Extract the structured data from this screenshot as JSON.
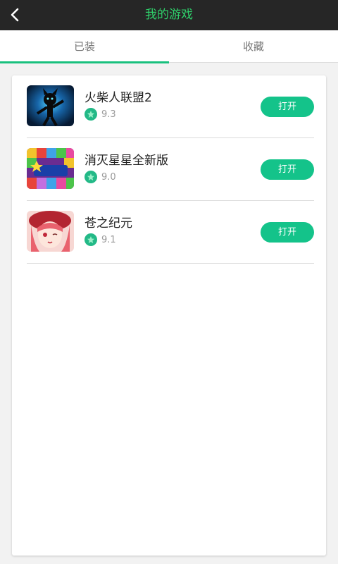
{
  "header": {
    "title": "我的游戏",
    "back_icon": "chevron-left-icon"
  },
  "tabs": [
    {
      "label": "已装",
      "active": true
    },
    {
      "label": "收藏",
      "active": false
    }
  ],
  "games": [
    {
      "name": "火柴人联盟2",
      "rating": "9.3",
      "action": "打开",
      "icon": "stickman-league-game-icon"
    },
    {
      "name": "消灭星星全新版",
      "rating": "9.0",
      "action": "打开",
      "icon": "popstar-game-icon"
    },
    {
      "name": "苍之纪元",
      "rating": "9.1",
      "action": "打开",
      "icon": "anime-girl-game-icon"
    }
  ],
  "colors": {
    "title_green": "#2fd16b",
    "accent": "#19c07e",
    "button": "#14c38a",
    "topbar": "#262626"
  }
}
